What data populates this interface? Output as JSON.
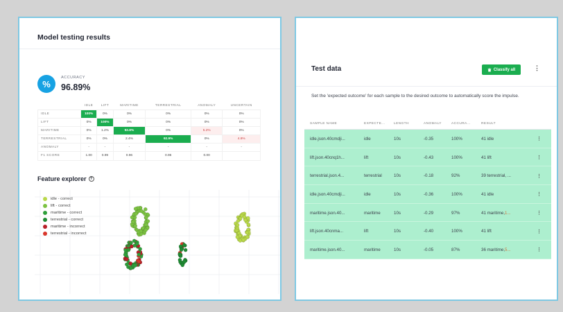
{
  "model_testing": {
    "title": "Model testing results",
    "accuracy_icon": "%",
    "accuracy_label": "ACCURACY",
    "accuracy_value": "96.89%",
    "matrix": {
      "headers": [
        "",
        "IDLE",
        "LIFT",
        "MARITIME",
        "TERRESTRIAL",
        "ANOMALY",
        "UNCERTAIN"
      ],
      "rows": [
        {
          "label": "IDLE",
          "cells": [
            "100%",
            "0%",
            "0%",
            "0%",
            "0%",
            "0%"
          ]
        },
        {
          "label": "LIFT",
          "cells": [
            "0%",
            "100%",
            "0%",
            "0%",
            "0%",
            "0%"
          ]
        },
        {
          "label": "MARITIME",
          "cells": [
            "0%",
            "1.2%",
            "92.8%",
            "0%",
            "5.2%",
            "0%"
          ]
        },
        {
          "label": "TERRESTRIAL",
          "cells": [
            "0%",
            "0%",
            "2.4%",
            "92.9%",
            "0%",
            "4.8%"
          ]
        },
        {
          "label": "ANOMALY",
          "cells": [
            "-",
            "-",
            "-",
            "-",
            "-",
            "-"
          ]
        },
        {
          "label": "F1 SCORE",
          "cells": [
            "1.00",
            "0.99",
            "0.96",
            "0.96",
            "0.00",
            ""
          ]
        }
      ]
    },
    "feature_explorer_title": "Feature explorer",
    "help_icon": "?",
    "legend": [
      {
        "label": "idle - correct",
        "color": "#b9d84a"
      },
      {
        "label": "lift - correct",
        "color": "#7cc242"
      },
      {
        "label": "maritime - correct",
        "color": "#2e9e3a"
      },
      {
        "label": "terrestrial - correct",
        "color": "#1f8a33"
      },
      {
        "label": "maritime - incorrect",
        "color": "#b8202a"
      },
      {
        "label": "terrestrial - incorrect",
        "color": "#d9362b"
      }
    ]
  },
  "test_data": {
    "title": "Test data",
    "classify_label": "Classify all",
    "kebab_icon": "⋮",
    "description": "Set the 'expected outcome' for each sample to the desired outcome to automatically score the impulse.",
    "columns": [
      "SAMPLE NAME",
      "EXPECTE...",
      "LENGTH",
      "ANOMALY",
      "ACCURA...",
      "RESULT"
    ],
    "rows": [
      {
        "name": "idle.json.40cmdji...",
        "expected": "idle",
        "length": "10s",
        "anomaly": "-0.35",
        "accuracy": "100%",
        "result": "41 idle",
        "result_extra": ""
      },
      {
        "name": "lift.json.40cnq1h...",
        "expected": "lift",
        "length": "10s",
        "anomaly": "-0.43",
        "accuracy": "100%",
        "result": "41 lift",
        "result_extra": ""
      },
      {
        "name": "terrestrial.json.4...",
        "expected": "terrestrial",
        "length": "10s",
        "anomaly": "-0.18",
        "accuracy": "92%",
        "result": "39 terrestrial, ...",
        "result_extra": ""
      },
      {
        "name": "idle.json.40cmdji...",
        "expected": "idle",
        "length": "10s",
        "anomaly": "-0.36",
        "accuracy": "100%",
        "result": "41 idle",
        "result_extra": ""
      },
      {
        "name": "maritime.json.40...",
        "expected": "maritime",
        "length": "10s",
        "anomaly": "-0.29",
        "accuracy": "97%",
        "result": "41 maritime, ",
        "result_extra": "1..."
      },
      {
        "name": "lift.json.40cnma...",
        "expected": "lift",
        "length": "10s",
        "anomaly": "-0.40",
        "accuracy": "100%",
        "result": "41 lift",
        "result_extra": ""
      },
      {
        "name": "maritime.json.40...",
        "expected": "maritime",
        "length": "10s",
        "anomaly": "-0.05",
        "accuracy": "87%",
        "result": "36 maritime, ",
        "result_extra": "5..."
      }
    ]
  }
}
